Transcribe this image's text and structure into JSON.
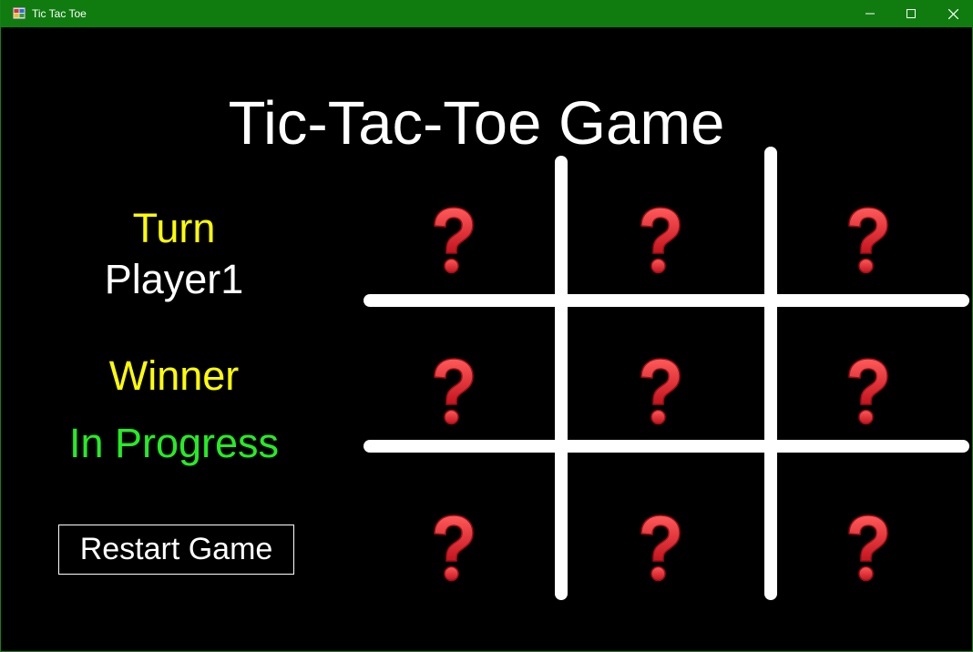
{
  "window": {
    "title": "Tic Tac Toe",
    "controls": [
      "minimize-icon",
      "maximize-icon",
      "close-icon"
    ],
    "titlebar_color": "#107c10"
  },
  "game": {
    "title": "Tic-Tac-Toe Game"
  },
  "status": {
    "turn_label": "Turn",
    "turn_player": "Player1",
    "winner_label": "Winner",
    "winner_value": "In Progress"
  },
  "controls": {
    "restart_label": "Restart Game"
  },
  "board": {
    "cells": [
      {
        "state": "empty",
        "icon": "question-mark-icon"
      },
      {
        "state": "empty",
        "icon": "question-mark-icon"
      },
      {
        "state": "empty",
        "icon": "question-mark-icon"
      },
      {
        "state": "empty",
        "icon": "question-mark-icon"
      },
      {
        "state": "empty",
        "icon": "question-mark-icon"
      },
      {
        "state": "empty",
        "icon": "question-mark-icon"
      },
      {
        "state": "empty",
        "icon": "question-mark-icon"
      },
      {
        "state": "empty",
        "icon": "question-mark-icon"
      },
      {
        "state": "empty",
        "icon": "question-mark-icon"
      }
    ],
    "line_color": "#ffffff",
    "mark_color": "#e8303a"
  },
  "colors": {
    "label_yellow": "#ffff00",
    "status_green": "#22ee22",
    "background": "#000000"
  }
}
